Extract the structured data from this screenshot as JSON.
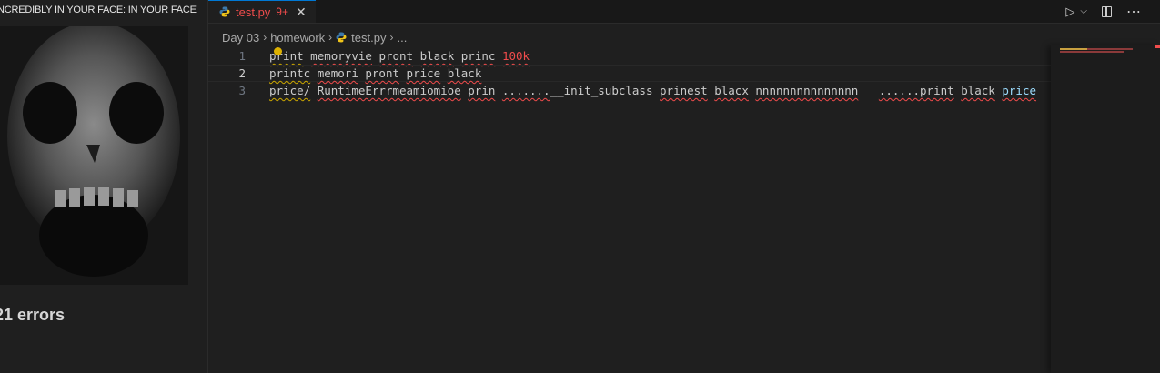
{
  "meme": {
    "caption": "NCREDIBLY IN YOUR FACE: IN YOUR FACE",
    "errors": "21 errors"
  },
  "tab": {
    "filename": "test.py",
    "problem_count": "9+",
    "close_glyph": "✕",
    "color": "#f14c4c"
  },
  "actions": {
    "run_glyph": "▷",
    "dropdown_glyph": "⌵",
    "more_glyph": "⋯"
  },
  "breadcrumb": {
    "items": [
      "Day 03",
      "homework",
      "test.py",
      "..."
    ],
    "separator": "›"
  },
  "editor": {
    "lines": [
      {
        "number": "1",
        "tokens": [
          {
            "text": "print",
            "style": "warn"
          },
          {
            "text": " ",
            "style": "plain"
          },
          {
            "text": "memoryvie",
            "style": "err"
          },
          {
            "text": " ",
            "style": "plain"
          },
          {
            "text": "pront",
            "style": "err"
          },
          {
            "text": " ",
            "style": "plain"
          },
          {
            "text": "black",
            "style": "err"
          },
          {
            "text": " ",
            "style": "plain"
          },
          {
            "text": "princ",
            "style": "err"
          },
          {
            "text": " ",
            "style": "plain"
          },
          {
            "text": "100k",
            "style": "num-err"
          }
        ]
      },
      {
        "number": "2",
        "current": true,
        "tokens": [
          {
            "text": "printc",
            "style": "warn"
          },
          {
            "text": " ",
            "style": "plain"
          },
          {
            "text": "memori",
            "style": "err"
          },
          {
            "text": " ",
            "style": "plain"
          },
          {
            "text": "pront",
            "style": "err"
          },
          {
            "text": " ",
            "style": "plain"
          },
          {
            "text": "price",
            "style": "err"
          },
          {
            "text": " ",
            "style": "plain"
          },
          {
            "text": "black",
            "style": "err"
          }
        ]
      },
      {
        "number": "3",
        "tokens": [
          {
            "text": "price/",
            "style": "warn"
          },
          {
            "text": " ",
            "style": "plain"
          },
          {
            "text": "RuntimeErrrmeamiomioe",
            "style": "err"
          },
          {
            "text": " ",
            "style": "plain"
          },
          {
            "text": "prin",
            "style": "err"
          },
          {
            "text": " ",
            "style": "plain"
          },
          {
            "text": ".......",
            "style": "err"
          },
          {
            "text": "__init_subclass",
            "style": "plain"
          },
          {
            "text": " ",
            "style": "plain"
          },
          {
            "text": "prinest",
            "style": "err"
          },
          {
            "text": " ",
            "style": "plain"
          },
          {
            "text": "blacx",
            "style": "err"
          },
          {
            "text": " ",
            "style": "plain"
          },
          {
            "text": "nnnnnnnnnnnnnnn",
            "style": "err"
          },
          {
            "text": "   ",
            "style": "plain"
          },
          {
            "text": "......print",
            "style": "err"
          },
          {
            "text": " ",
            "style": "plain"
          },
          {
            "text": "black",
            "style": "err"
          },
          {
            "text": " ",
            "style": "plain"
          },
          {
            "text": "price",
            "style": "cyan-err"
          }
        ]
      }
    ]
  },
  "colors": {
    "error": "#f14c4c",
    "warning": "#cca700",
    "accent": "#0078d4"
  }
}
